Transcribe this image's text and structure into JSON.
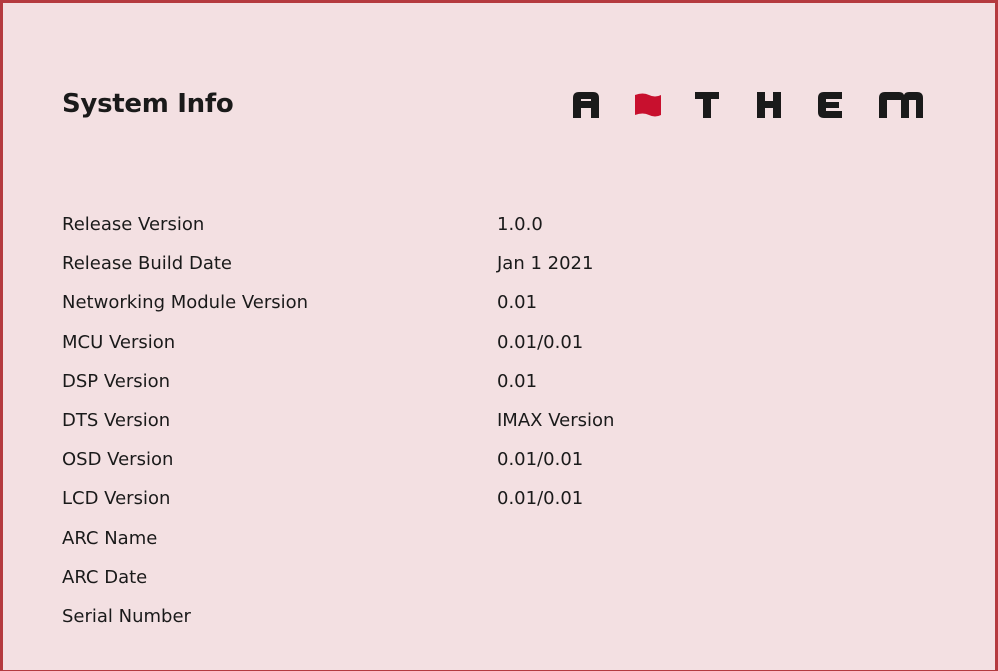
{
  "page": {
    "title": "System Info",
    "brand": "ANTHEM"
  },
  "colors": {
    "background": "#f3e0e2",
    "border": "#b43a3f",
    "logo_text": "#1a1a1a",
    "logo_flag": "#c8102e"
  },
  "icons": {
    "logo": "anthem-logo-icon"
  },
  "info_rows": [
    {
      "label": "Release Version",
      "value": "1.0.0"
    },
    {
      "label": "Release Build Date",
      "value": "Jan 1 2021"
    },
    {
      "label": "Networking Module Version",
      "value": "0.01"
    },
    {
      "label": "MCU Version",
      "value": "0.01/0.01"
    },
    {
      "label": "DSP Version",
      "value": "0.01"
    },
    {
      "label": "DTS Version",
      "value": "IMAX Version"
    },
    {
      "label": "OSD Version",
      "value": "0.01/0.01"
    },
    {
      "label": "LCD Version",
      "value": "0.01/0.01"
    },
    {
      "label": "ARC Name",
      "value": ""
    },
    {
      "label": "ARC Date",
      "value": ""
    },
    {
      "label": "Serial Number",
      "value": ""
    }
  ]
}
